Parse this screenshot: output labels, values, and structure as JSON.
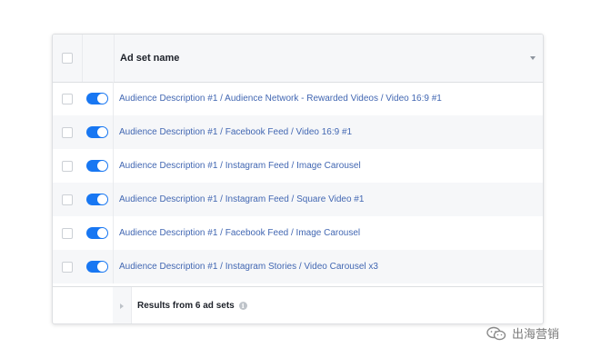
{
  "table": {
    "header": {
      "column_label": "Ad set name"
    },
    "rows": [
      {
        "name": "Audience Description #1 / Audience Network - Rewarded Videos / Video 16:9 #1",
        "enabled": true
      },
      {
        "name": "Audience Description #1 / Facebook Feed / Video 16:9 #1",
        "enabled": true
      },
      {
        "name": "Audience Description #1 / Instagram Feed / Image Carousel",
        "enabled": true
      },
      {
        "name": "Audience Description #1 / Instagram Feed / Square Video #1",
        "enabled": true
      },
      {
        "name": "Audience Description #1 / Facebook Feed / Image Carousel",
        "enabled": true
      },
      {
        "name": "Audience Description #1 / Instagram Stories / Video Carousel x3",
        "enabled": true
      }
    ],
    "footer": {
      "results_label": "Results from 6 ad sets",
      "info_icon": "i"
    }
  },
  "watermark": {
    "text": "出海营销",
    "icon": "wechat-logo-icon"
  },
  "colors": {
    "toggle_on": "#1877f2",
    "link": "#4267b2",
    "header_bg": "#f6f7f9",
    "alt_row_bg": "#f6f7f9"
  }
}
